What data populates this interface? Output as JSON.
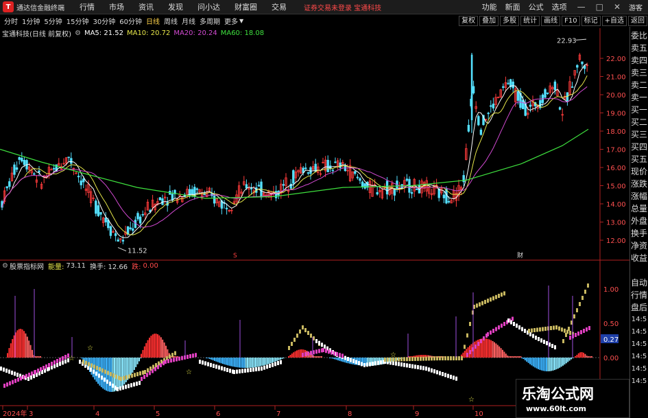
{
  "app": {
    "name": "通达信金融终端",
    "logo_char": "T"
  },
  "menu": [
    "行情",
    "市场",
    "资讯",
    "发现",
    "问小达",
    "财富圈",
    "交易"
  ],
  "notice": "证券交易未登录  宝通科技",
  "right_menu": [
    "功能",
    "新面",
    "公式",
    "选项"
  ],
  "window_buttons": [
    "—",
    "□",
    "✕"
  ],
  "guest_label": "游客",
  "periods": [
    "分时",
    "1分钟",
    "5分钟",
    "15分钟",
    "30分钟",
    "60分钟",
    "日线",
    "周线",
    "月线",
    "多周期",
    "更多"
  ],
  "active_period": "日线",
  "tool_buttons": [
    "复权",
    "叠加",
    "多股",
    "统计",
    "画线",
    "F10",
    "标记",
    "+自选",
    "返回"
  ],
  "main_info": {
    "title": "宝通科技(日线 前复权)",
    "ma5": "MA5: 21.52",
    "ma10": "MA10: 20.72",
    "ma20": "MA20: 20.24",
    "ma60": "MA60: 18.08"
  },
  "indicator_info": {
    "name": "股票指标网",
    "energy_label": "能量:",
    "energy_value": "73.11",
    "turnover": "换手: 12.66",
    "fall_label": "跌:",
    "fall_value": "0.00"
  },
  "price_axis": [
    "22.00",
    "21.00",
    "20.00",
    "19.00",
    "18.00",
    "17.00",
    "16.00",
    "15.00",
    "14.00",
    "13.00",
    "12.00"
  ],
  "lower_axis": [
    "1.00",
    "0.50",
    "0.27",
    "0.00"
  ],
  "annotations": {
    "high": "22.93",
    "low": "11.52",
    "marker_s": "S",
    "marker_cai": "财"
  },
  "time_axis": [
    "2024年",
    "3",
    "4",
    "5",
    "6",
    "7",
    "8",
    "9",
    "10"
  ],
  "side_panel": [
    "委比",
    "卖五",
    "卖四",
    "卖三",
    "卖二",
    "卖一",
    "买一",
    "买二",
    "买三",
    "买四",
    "买五",
    "现价",
    "涨跌",
    "涨幅",
    "总量",
    "外盘",
    "换手",
    "净资",
    "收益",
    "",
    "自动",
    "行情",
    "盘后",
    "14:5",
    "14:5",
    "14:5",
    "14:5",
    "14:5",
    "14:5"
  ],
  "watermark": {
    "line1": "乐淘公式网",
    "line2": "www.60lt.com"
  },
  "colors": {
    "up": "#ff3b3b",
    "down": "#54e0ff",
    "ma5": "#ffffff",
    "ma10": "#e6e64a",
    "ma20": "#d24ad2",
    "ma60": "#3ee03e",
    "axis": "#b02020",
    "accent_notice": "#ff4a4a"
  }
}
